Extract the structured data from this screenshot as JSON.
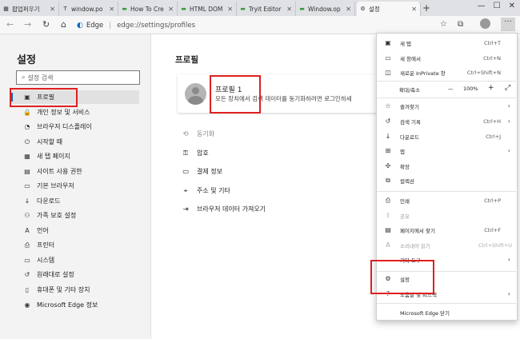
{
  "tabs": [
    {
      "label": "팝업퍼우기",
      "fav": "▦"
    },
    {
      "label": "window.po",
      "fav": "T"
    },
    {
      "label": "How To Cre",
      "fav": "▬"
    },
    {
      "label": "HTML DOM",
      "fav": "▬"
    },
    {
      "label": "Tryit Editor",
      "fav": "▬"
    },
    {
      "label": "Window.op",
      "fav": "▬"
    },
    {
      "label": "설정",
      "fav": "⚙"
    }
  ],
  "address": {
    "brand": "Edge",
    "path": "edge://settings/profiles"
  },
  "sidebar": {
    "title": "설정",
    "search_placeholder": "설정 검색",
    "items": [
      {
        "label": "프로필",
        "icon": "▣"
      },
      {
        "label": "개인 정보 및 서비스",
        "icon": "🔒"
      },
      {
        "label": "브라우저 디스플레이",
        "icon": "◔"
      },
      {
        "label": "시작할 때",
        "icon": "⏻"
      },
      {
        "label": "새 탭 페이지",
        "icon": "▦"
      },
      {
        "label": "사이트 사용 권한",
        "icon": "▤"
      },
      {
        "label": "기본 브라우저",
        "icon": "▭"
      },
      {
        "label": "다운로드",
        "icon": "↓"
      },
      {
        "label": "가족 보호 설정",
        "icon": "⚇"
      },
      {
        "label": "언어",
        "icon": "A"
      },
      {
        "label": "프린터",
        "icon": "⎙"
      },
      {
        "label": "시스템",
        "icon": "▭"
      },
      {
        "label": "원래대로 설정",
        "icon": "↺"
      },
      {
        "label": "휴대폰 및 기타 장치",
        "icon": "▯"
      },
      {
        "label": "Microsoft Edge 정보",
        "icon": "◉"
      }
    ]
  },
  "main": {
    "title": "프로필",
    "profile_name": "프로필 1",
    "profile_desc": "모든 장치에서 검색 데이터를 동기화하려면 로그인하세",
    "links": [
      {
        "label": "동기화",
        "icon": "⟲"
      },
      {
        "label": "암호",
        "icon": "⚿"
      },
      {
        "label": "결제 정보",
        "icon": "▭"
      },
      {
        "label": "주소 및 기타",
        "icon": "⌖"
      },
      {
        "label": "브라우저 데이터 가져오기",
        "icon": "⇥"
      }
    ]
  },
  "menu": {
    "new_tab": "새 탭",
    "new_tab_sc": "Ctrl+T",
    "new_window": "새 창에서",
    "new_window_sc": "Ctrl+N",
    "new_private": "새로운 InPrivate 창",
    "new_private_sc": "Ctrl+Shift+N",
    "zoom_label": "확대/축소",
    "zoom_minus": "—",
    "zoom_value": "100%",
    "zoom_plus": "+",
    "favorites": "즐겨찾기",
    "history": "검색 기록",
    "history_sc": "Ctrl+H",
    "downloads": "다운로드",
    "downloads_sc": "Ctrl+J",
    "apps": "앱",
    "extensions": "확장",
    "collections": "컬렉션",
    "print": "인쇄",
    "print_sc": "Ctrl+P",
    "share": "공유",
    "find": "페이지에서 찾기",
    "find_sc": "Ctrl+F",
    "read_aloud": "소리내어 읽기",
    "read_aloud_sc": "Ctrl+Shift+U",
    "more_tools": "기타 도구",
    "settings": "설정",
    "help": "도움말 및 피드백",
    "close": "Microsoft Edge 닫기"
  },
  "colors": {
    "highlight": "#e02020",
    "accent": "#0a66c2"
  }
}
